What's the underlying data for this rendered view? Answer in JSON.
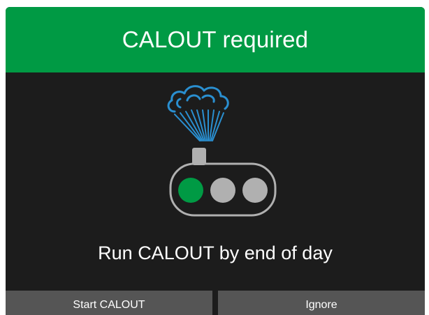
{
  "dialog": {
    "title": "CALOUT required",
    "message": "Run CALOUT by end of day",
    "buttons": {
      "start_label": "Start CALOUT",
      "ignore_label": "Ignore"
    }
  },
  "colors": {
    "accent": "#009a44",
    "status_active": "#009a44",
    "status_inactive": "#b0b0b0",
    "cloud": "#2a8fd0",
    "dialog_background": "#1c1c1c",
    "button_background": "#555555"
  },
  "icons": {
    "illustration": "cloud-sync-device-icon",
    "status_lights": [
      "active",
      "inactive",
      "inactive"
    ]
  }
}
